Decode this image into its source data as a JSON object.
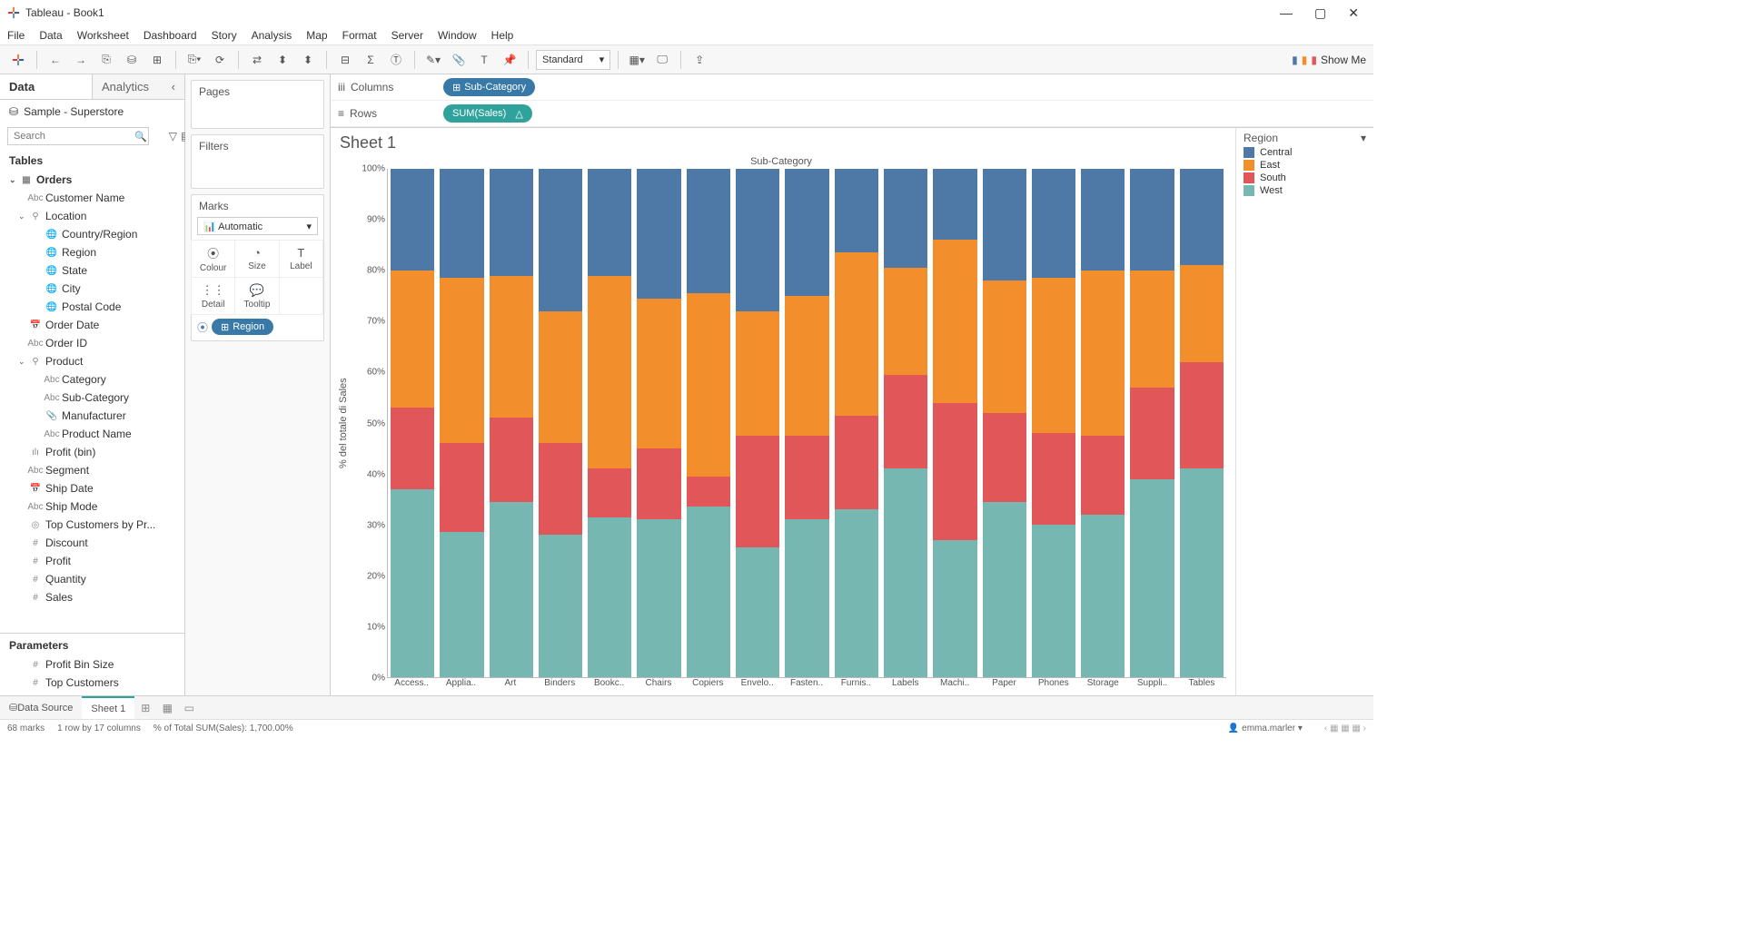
{
  "app": {
    "title": "Tableau - Book1"
  },
  "menus": [
    "File",
    "Data",
    "Worksheet",
    "Dashboard",
    "Story",
    "Analysis",
    "Map",
    "Format",
    "Server",
    "Window",
    "Help"
  ],
  "toolbar": {
    "fit": "Standard",
    "showme": "Show Me"
  },
  "sidebar": {
    "tabs": {
      "data": "Data",
      "analytics": "Analytics"
    },
    "datasource": "Sample - Superstore",
    "search_placeholder": "Search",
    "tables_label": "Tables",
    "params_label": "Parameters",
    "tree": [
      {
        "t": "tbl",
        "l": "Orders",
        "lvl": 0,
        "caret": "v"
      },
      {
        "t": "abc",
        "l": "Customer Name",
        "lvl": 1
      },
      {
        "t": "geo",
        "l": "Location",
        "lvl": 1,
        "caret": "v"
      },
      {
        "t": "globe",
        "l": "Country/Region",
        "lvl": 2
      },
      {
        "t": "globe",
        "l": "Region",
        "lvl": 2
      },
      {
        "t": "globe",
        "l": "State",
        "lvl": 2
      },
      {
        "t": "globe",
        "l": "City",
        "lvl": 2
      },
      {
        "t": "globe",
        "l": "Postal Code",
        "lvl": 2
      },
      {
        "t": "date",
        "l": "Order Date",
        "lvl": 1
      },
      {
        "t": "abc",
        "l": "Order ID",
        "lvl": 1
      },
      {
        "t": "prod",
        "l": "Product",
        "lvl": 1,
        "caret": "v"
      },
      {
        "t": "abc",
        "l": "Category",
        "lvl": 2
      },
      {
        "t": "abc",
        "l": "Sub-Category",
        "lvl": 2
      },
      {
        "t": "clip",
        "l": "Manufacturer",
        "lvl": 2
      },
      {
        "t": "abc",
        "l": "Product Name",
        "lvl": 2
      },
      {
        "t": "bin",
        "l": "Profit (bin)",
        "lvl": 1
      },
      {
        "t": "abc",
        "l": "Segment",
        "lvl": 1
      },
      {
        "t": "date",
        "l": "Ship Date",
        "lvl": 1
      },
      {
        "t": "abc",
        "l": "Ship Mode",
        "lvl": 1
      },
      {
        "t": "set",
        "l": "Top Customers by Pr...",
        "lvl": 1
      },
      {
        "t": "num",
        "l": "Discount",
        "lvl": 1
      },
      {
        "t": "num",
        "l": "Profit",
        "lvl": 1
      },
      {
        "t": "num",
        "l": "Quantity",
        "lvl": 1
      },
      {
        "t": "num",
        "l": "Sales",
        "lvl": 1
      }
    ],
    "params": [
      {
        "t": "num",
        "l": "Profit Bin Size"
      },
      {
        "t": "num",
        "l": "Top Customers"
      }
    ]
  },
  "cards": {
    "pages": "Pages",
    "filters": "Filters",
    "marks": "Marks",
    "marktype": "Automatic",
    "cells": [
      "Colour",
      "Size",
      "Label",
      "Detail",
      "Tooltip"
    ],
    "colour_pill": "Region"
  },
  "shelves": {
    "columns_label": "Columns",
    "rows_label": "Rows",
    "columns_pill": "Sub-Category",
    "rows_pill": "SUM(Sales)"
  },
  "viz": {
    "title": "Sheet 1",
    "xtitle": "Sub-Category",
    "ytitle": "% del totale di Sales",
    "legend_title": "Region"
  },
  "legend_items": [
    {
      "name": "Central",
      "color": "#4e79a7"
    },
    {
      "name": "East",
      "color": "#f28e2b"
    },
    {
      "name": "South",
      "color": "#e15759"
    },
    {
      "name": "West",
      "color": "#76b7b2"
    }
  ],
  "bottom": {
    "datasource": "Data Source",
    "sheet": "Sheet 1"
  },
  "status": {
    "marks": "68 marks",
    "rowcol": "1 row by 17 columns",
    "calc": "% of Total SUM(Sales): 1,700.00%",
    "user": "emma.marler"
  },
  "chart_data": {
    "type": "bar",
    "stacked": true,
    "percent": true,
    "title": "Sheet 1",
    "xlabel": "Sub-Category",
    "ylabel": "% del totale di Sales",
    "ylim": [
      0,
      100
    ],
    "yticks": [
      0,
      10,
      20,
      30,
      40,
      50,
      60,
      70,
      80,
      90,
      100
    ],
    "categories": [
      "Access..",
      "Applia..",
      "Art",
      "Binders",
      "Bookc..",
      "Chairs",
      "Copiers",
      "Envelo..",
      "Fasten..",
      "Furnis..",
      "Labels",
      "Machi..",
      "Paper",
      "Phones",
      "Storage",
      "Suppli..",
      "Tables"
    ],
    "series": [
      {
        "name": "West",
        "color": "#76b7b2",
        "values": [
          37,
          28.5,
          34.5,
          28,
          31.5,
          31,
          33.5,
          25.5,
          31,
          33,
          41,
          27,
          34.5,
          30,
          32,
          39,
          41
        ]
      },
      {
        "name": "South",
        "color": "#e15759",
        "values": [
          16,
          17.5,
          16.5,
          18,
          9.5,
          14,
          6,
          22,
          16.5,
          18.5,
          18.5,
          27,
          17.5,
          18,
          15.5,
          18,
          21
        ]
      },
      {
        "name": "East",
        "color": "#f28e2b",
        "values": [
          27,
          32.5,
          28,
          26,
          38,
          29.5,
          36,
          24.5,
          27.5,
          32,
          21,
          32,
          26,
          30.5,
          32.5,
          23,
          19
        ]
      },
      {
        "name": "Central",
        "color": "#4e79a7",
        "values": [
          20,
          21.5,
          21,
          28,
          21,
          25.5,
          24.5,
          28,
          25,
          16.5,
          19.5,
          14,
          22,
          21.5,
          20,
          20,
          19
        ]
      }
    ],
    "legend": [
      "Central",
      "East",
      "South",
      "West"
    ]
  }
}
